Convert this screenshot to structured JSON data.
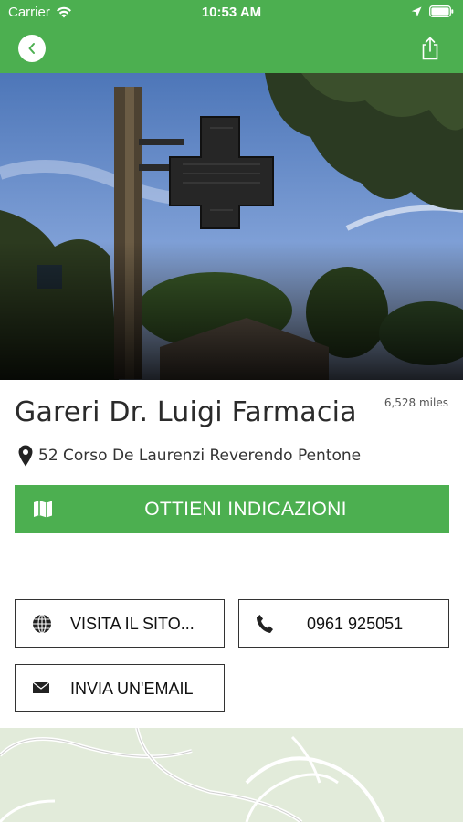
{
  "status_bar": {
    "carrier": "Carrier",
    "time": "10:53 AM"
  },
  "nav": {
    "back_icon": "chevron-left-icon",
    "share_icon": "share-icon"
  },
  "colors": {
    "brand_green": "#4caf50"
  },
  "pharmacy": {
    "name": "Gareri Dr. Luigi Farmacia",
    "distance": "6,528 miles",
    "address": "52 Corso De Laurenzi Reverendo Pentone"
  },
  "actions": {
    "directions_label": "OTTIENI INDICAZIONI",
    "website_label": "VISITA IL SITO...",
    "phone_label": "0961 925051",
    "email_label": "INVIA UN'EMAIL"
  }
}
